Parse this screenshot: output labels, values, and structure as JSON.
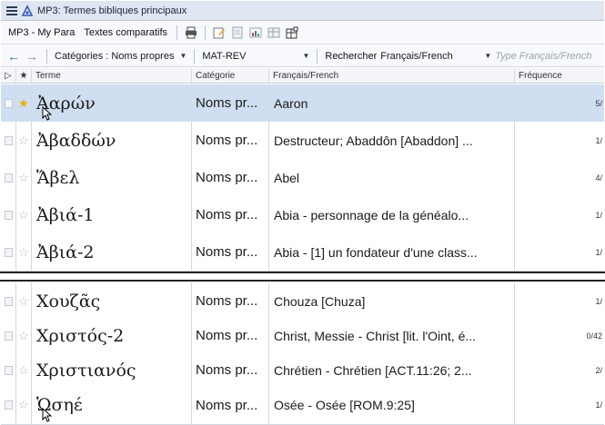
{
  "window": {
    "title": "MP3: Termes bibliques principaux"
  },
  "toolbar1": {
    "resource_label": "MP3 - My Para",
    "compare_label": "Textes comparatifs",
    "icons": [
      "print-icon",
      "edit-icon",
      "document-icon",
      "chart-icon",
      "grid-icon",
      "layout-icon"
    ]
  },
  "toolbar2": {
    "back_icon": "←",
    "forward_icon": "→",
    "category_label": "Catégories : Noms propres",
    "scope_label": "MAT-REV",
    "search_label": "Rechercher",
    "search_language": "Français/French",
    "search_placeholder": "Type Français/French"
  },
  "columns": {
    "flag": "▷",
    "star": "★",
    "term": "Terme",
    "category": "Catégorie",
    "french": "Français/French",
    "frequency": "Fréquence"
  },
  "rows_top": [
    {
      "term": "Ἀαρών",
      "category": "Noms pr...",
      "french": "Aaron",
      "freq": "5/",
      "selected": true,
      "starred": true
    },
    {
      "term": "Ἀβαδδών",
      "category": "Noms pr...",
      "french": "Destructeur; Abaddôn [Abaddon] ...",
      "freq": "1/"
    },
    {
      "term": "Ἅβελ",
      "category": "Noms pr...",
      "french": "Abel",
      "freq": "4/"
    },
    {
      "term": "Ἀβιά-1",
      "category": "Noms pr...",
      "french": "Abia - personnage de la généalo...",
      "freq": "1/"
    },
    {
      "term": "Ἀβιά-2",
      "category": "Noms pr...",
      "french": "Abia - [1] un fondateur d'une class...",
      "freq": "1/"
    }
  ],
  "rows_bottom": [
    {
      "term": "Χουζᾶς",
      "category": "Noms pr...",
      "french": "Chouza [Chuza]",
      "freq": "1/"
    },
    {
      "term": "Χριστός-2",
      "category": "Noms pr...",
      "french": "Christ, Messie - Christ [lit. l'Oint, é...",
      "freq": "0/42"
    },
    {
      "term": "Χριστιανός",
      "category": "Noms pr...",
      "french": "Chrétien - Chrétien [ACT.11:26; 2...",
      "freq": "2/"
    },
    {
      "term": "Ὡσηέ",
      "category": "Noms pr...",
      "french": "Osée - Osée [ROM.9:25]",
      "freq": "1/"
    }
  ],
  "colors": {
    "selected_row": "#cfdef1",
    "star": "#e4b100",
    "accent": "#1d5fb8"
  }
}
